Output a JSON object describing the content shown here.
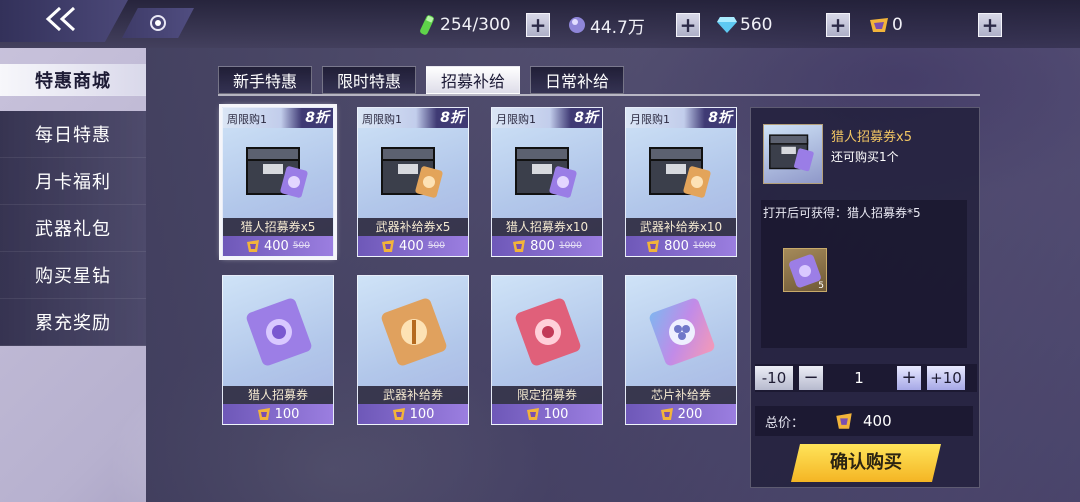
{
  "topbar": {
    "resources": [
      {
        "icon": "stamina-vial-icon",
        "value": "254/300"
      },
      {
        "icon": "crystal-orb-icon",
        "value": "44.7万"
      },
      {
        "icon": "blue-diamond-icon",
        "value": "560"
      },
      {
        "icon": "gold-star-diamond-icon",
        "value": "0"
      }
    ],
    "plus_label": "+"
  },
  "sidebar": {
    "items": [
      {
        "label": "特惠商城"
      },
      {
        "label": "每日特惠"
      },
      {
        "label": "月卡福利"
      },
      {
        "label": "武器礼包"
      },
      {
        "label": "购买星钻"
      },
      {
        "label": "累充奖励"
      }
    ]
  },
  "tabs": [
    {
      "label": "新手特惠"
    },
    {
      "label": "限时特惠"
    },
    {
      "label": "招募补给"
    },
    {
      "label": "日常补给"
    }
  ],
  "cards": [
    {
      "limit": "周限购1",
      "discount": "8折",
      "name": "猎人招募券x5",
      "price": "400",
      "old_price": "500",
      "art": "supply-crate-purple"
    },
    {
      "limit": "周限购1",
      "discount": "8折",
      "name": "武器补给券x5",
      "price": "400",
      "old_price": "500",
      "art": "supply-crate-orange"
    },
    {
      "limit": "月限购1",
      "discount": "8折",
      "name": "猎人招募券x10",
      "price": "800",
      "old_price": "1000",
      "art": "supply-crate-purple"
    },
    {
      "limit": "月限购1",
      "discount": "8折",
      "name": "武器补给券x10",
      "price": "800",
      "old_price": "1000",
      "art": "supply-crate-orange"
    },
    {
      "name": "猎人招募券",
      "price": "100",
      "art": "ticket-purple"
    },
    {
      "name": "武器补给券",
      "price": "100",
      "art": "ticket-orange"
    },
    {
      "name": "限定招募券",
      "price": "100",
      "art": "ticket-pink"
    },
    {
      "name": "芯片补给券",
      "price": "200",
      "art": "ticket-holo"
    }
  ],
  "detail": {
    "name": "猎人招募券x5",
    "remaining": "还可购买1个",
    "reward_label": "打开后可获得：猎人招募券*5",
    "reward_count": "5",
    "qty_minus10": "-10",
    "qty_minus": "−",
    "qty_value": "1",
    "qty_plus": "+",
    "qty_plus10": "+10",
    "total_label": "总价：",
    "total_value": "400",
    "buy_label": "确认购买"
  },
  "colors": {
    "accent_gold": "#f4b524",
    "price_purple": "#7e67c9",
    "title_gold": "#f2c663"
  }
}
